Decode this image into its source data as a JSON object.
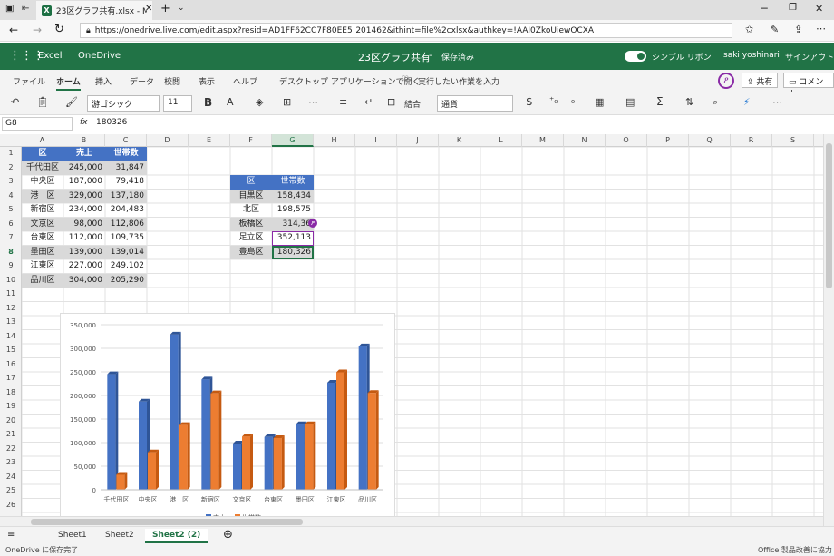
{
  "browser": {
    "tab_title": "23区グラフ共有.xlsx - Mic",
    "url": "https://onedrive.live.com/edit.aspx?resid=AD1FF62CC7F80EE5!201462&ithint=file%2cxlsx&authkey=!AAI0ZkoUiewOCXA",
    "url_bold": "onedrive.live.com"
  },
  "app": {
    "name": "Excel",
    "service": "OneDrive",
    "doc_title": "23区グラフ共有",
    "separator": "-",
    "save_status": "保存済み",
    "simple_ribbon": "シンプル リボン",
    "user": "saki yoshinari",
    "signout": "サインアウト"
  },
  "menu": {
    "file": "ファイル",
    "home": "ホーム",
    "insert": "挿入",
    "data": "データ",
    "review": "校閲",
    "view": "表示",
    "help": "ヘルプ",
    "desktop": "デスクトップ アプリケーションで開く",
    "tellme": "実行したい作業を入力",
    "share": "共有",
    "comment": "コメント"
  },
  "toolbar": {
    "font": "游ゴシック",
    "size": "11",
    "bold": "B",
    "merge": "結合",
    "format": "通貨",
    "currency": "$"
  },
  "formula": {
    "namebox": "G8",
    "fx": "fx",
    "value": "180326"
  },
  "columns": [
    "A",
    "B",
    "C",
    "D",
    "E",
    "F",
    "G",
    "H",
    "I",
    "J",
    "K",
    "L",
    "M",
    "N",
    "O",
    "P",
    "Q",
    "R",
    "S"
  ],
  "rows": [
    "1",
    "2",
    "3",
    "4",
    "5",
    "6",
    "7",
    "8",
    "9",
    "10",
    "11",
    "12",
    "13",
    "14",
    "15",
    "16",
    "17",
    "18",
    "19",
    "20",
    "21",
    "22",
    "23",
    "24",
    "25",
    "26"
  ],
  "table1": {
    "headers": [
      "区",
      "売上",
      "世帯数"
    ],
    "rows": [
      [
        "千代田区",
        "245,000",
        "31,847"
      ],
      [
        "中央区",
        "187,000",
        "79,418"
      ],
      [
        "港　区",
        "329,000",
        "137,180"
      ],
      [
        "新宿区",
        "234,000",
        "204,483"
      ],
      [
        "文京区",
        "98,000",
        "112,806"
      ],
      [
        "台東区",
        "112,000",
        "109,735"
      ],
      [
        "墨田区",
        "139,000",
        "139,014"
      ],
      [
        "江東区",
        "227,000",
        "249,102"
      ],
      [
        "品川区",
        "304,000",
        "205,290"
      ]
    ]
  },
  "table2": {
    "headers": [
      "区",
      "世帯数"
    ],
    "rows": [
      [
        "目黒区",
        "158,434"
      ],
      [
        "北区",
        "198,575"
      ],
      [
        "板橋区",
        "314,36"
      ],
      [
        "足立区",
        "352,113"
      ],
      [
        "豊島区",
        "180,326"
      ]
    ]
  },
  "chart_data": {
    "type": "bar",
    "categories": [
      "千代田区",
      "中央区",
      "港　区",
      "新宿区",
      "文京区",
      "台東区",
      "墨田区",
      "江東区",
      "品川区"
    ],
    "series": [
      {
        "name": "売上",
        "values": [
          245000,
          187000,
          329000,
          234000,
          98000,
          112000,
          139000,
          227000,
          304000
        ],
        "color": "#4472c4"
      },
      {
        "name": "世帯数",
        "values": [
          31847,
          79418,
          137180,
          204483,
          112806,
          109735,
          139014,
          249102,
          205290
        ],
        "color": "#ed7d31"
      }
    ],
    "ylim": [
      0,
      350000
    ],
    "yticks": [
      "0",
      "50,000",
      "100,000",
      "150,000",
      "200,000",
      "250,000",
      "300,000",
      "350,000"
    ],
    "grid": true
  },
  "sheets": [
    "Sheet1",
    "Sheet2",
    "Sheet2 (2)"
  ],
  "status": {
    "left": "OneDrive に保存完了",
    "right": "Office 製品改善に協力"
  },
  "colors": {
    "excel_green": "#217346",
    "header_blue": "#4472c4",
    "band": "#d9d9d9"
  }
}
